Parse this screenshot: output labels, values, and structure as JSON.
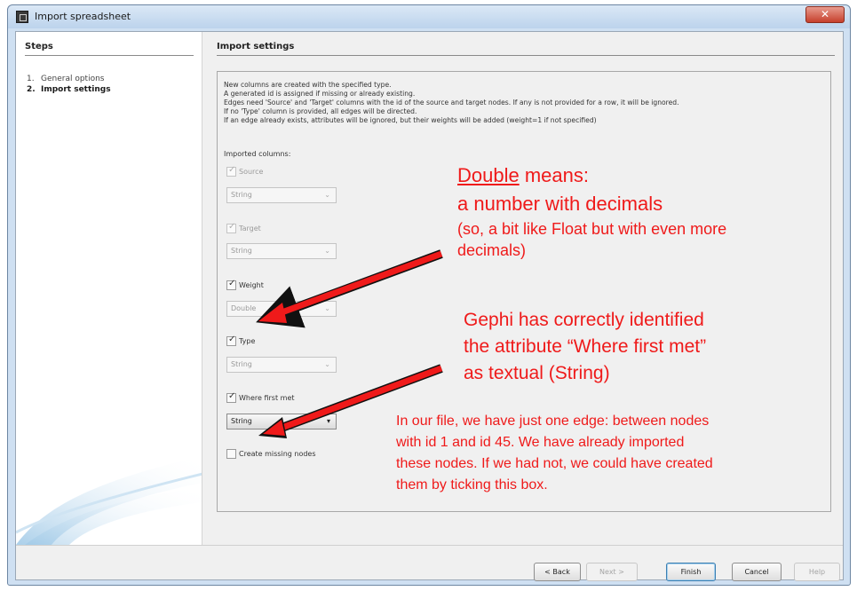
{
  "window": {
    "title": "Import spreadsheet",
    "close_label": "✕"
  },
  "steps": {
    "heading": "Steps",
    "items": [
      {
        "num": "1.",
        "label": "General options"
      },
      {
        "num": "2.",
        "label": "Import settings"
      }
    ]
  },
  "settings": {
    "heading": "Import settings",
    "info_lines": [
      "New columns are created with the specified type.",
      "A generated id is assigned if missing or already existing.",
      "Edges need 'Source' and 'Target' columns with the id of the source and target nodes. If any is not provided for a row, it will be ignored.",
      "If no 'Type' column is provided, all edges will be directed.",
      "If an edge already exists, attributes will be ignored, but their weights will be added (weight=1 if not specified)"
    ],
    "imported_columns_label": "Imported columns:",
    "columns": [
      {
        "label": "Source",
        "checked": true,
        "enabled": false,
        "type": "String"
      },
      {
        "label": "Target",
        "checked": true,
        "enabled": false,
        "type": "String"
      },
      {
        "label": "Weight",
        "checked": true,
        "enabled": true,
        "type": "Double"
      },
      {
        "label": "Type",
        "checked": true,
        "enabled": true,
        "type": "String"
      },
      {
        "label": "Where first met",
        "checked": true,
        "enabled": true,
        "type": "String"
      }
    ],
    "create_missing_nodes": {
      "label": "Create missing nodes",
      "checked": false
    }
  },
  "annotations": {
    "double": {
      "word": "Double",
      "rest": " means:",
      "line2": "a number with decimals",
      "line3": "(so, a bit like Float but with even more",
      "line4": "decimals)"
    },
    "gephi": {
      "line1": "Gephi has correctly identified",
      "line2": "the attribute “Where first met”",
      "line3": "as textual (String)"
    },
    "file": {
      "line1": "In our file, we have just one edge: between nodes",
      "line2": "with id 1 and id 45. We have already imported",
      "line3": "these nodes. If we had not, we could have created",
      "line4": "them by ticking this box."
    },
    "color": "#ef1a1a"
  },
  "buttons": {
    "back": "< Back",
    "next": "Next >",
    "finish": "Finish",
    "cancel": "Cancel",
    "help": "Help"
  }
}
